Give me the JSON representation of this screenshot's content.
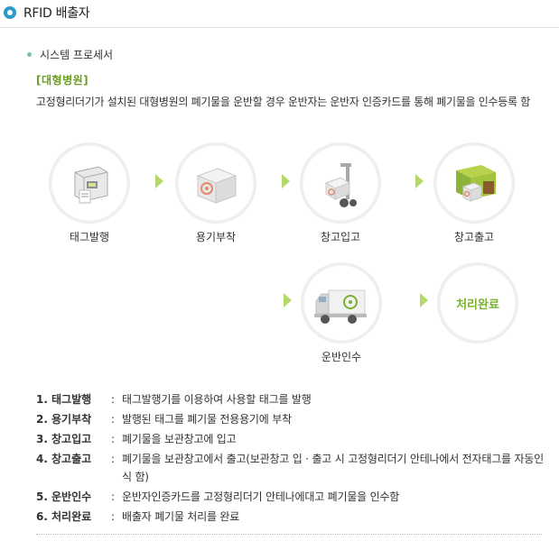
{
  "page": {
    "title": "RFID 배출자",
    "section": "시스템 프로세서",
    "subheading": "[대형병원]",
    "description": "고정형리더기가 설치된 대형병원의 폐기물을 운반할 경우 운반자는 운반자 인증카드를 통해 폐기물을 인수등록 함"
  },
  "steps": [
    {
      "label": "태그발행",
      "icon": "tag-printer-icon"
    },
    {
      "label": "용기부착",
      "icon": "biohazard-box-icon"
    },
    {
      "label": "창고입고",
      "icon": "hand-truck-icon"
    },
    {
      "label": "창고출고",
      "icon": "storage-container-icon"
    },
    {
      "label": "운반인수",
      "icon": "truck-icon"
    },
    {
      "label": "처리완료",
      "icon": ""
    }
  ],
  "list": [
    {
      "num": "1.",
      "term": "태그발행",
      "def": "태그발행기를 이용하여 사용할 태그를 발행"
    },
    {
      "num": "2.",
      "term": "용기부착",
      "def": "발행된 태그를 폐기물 전용용기에 부착"
    },
    {
      "num": "3.",
      "term": "창고입고",
      "def": "폐기물을 보관창고에 입고"
    },
    {
      "num": "4.",
      "term": "창고출고",
      "def": "폐기물을 보관창고에서 출고(보관창고 입 · 출고 시 고정형리더기 안테나에서 전자태그를 자동인식 함)"
    },
    {
      "num": "5.",
      "term": "운반인수",
      "def": "운반자인증카드를 고정형리더기 안테나에대고 폐기물을 인수함"
    },
    {
      "num": "6.",
      "term": "처리완료",
      "def": "배출자 폐기물 처리를 완료"
    }
  ],
  "colors": {
    "accent": "#2c9bc9",
    "green": "#7ab030",
    "arrow": "#b5d86a"
  }
}
